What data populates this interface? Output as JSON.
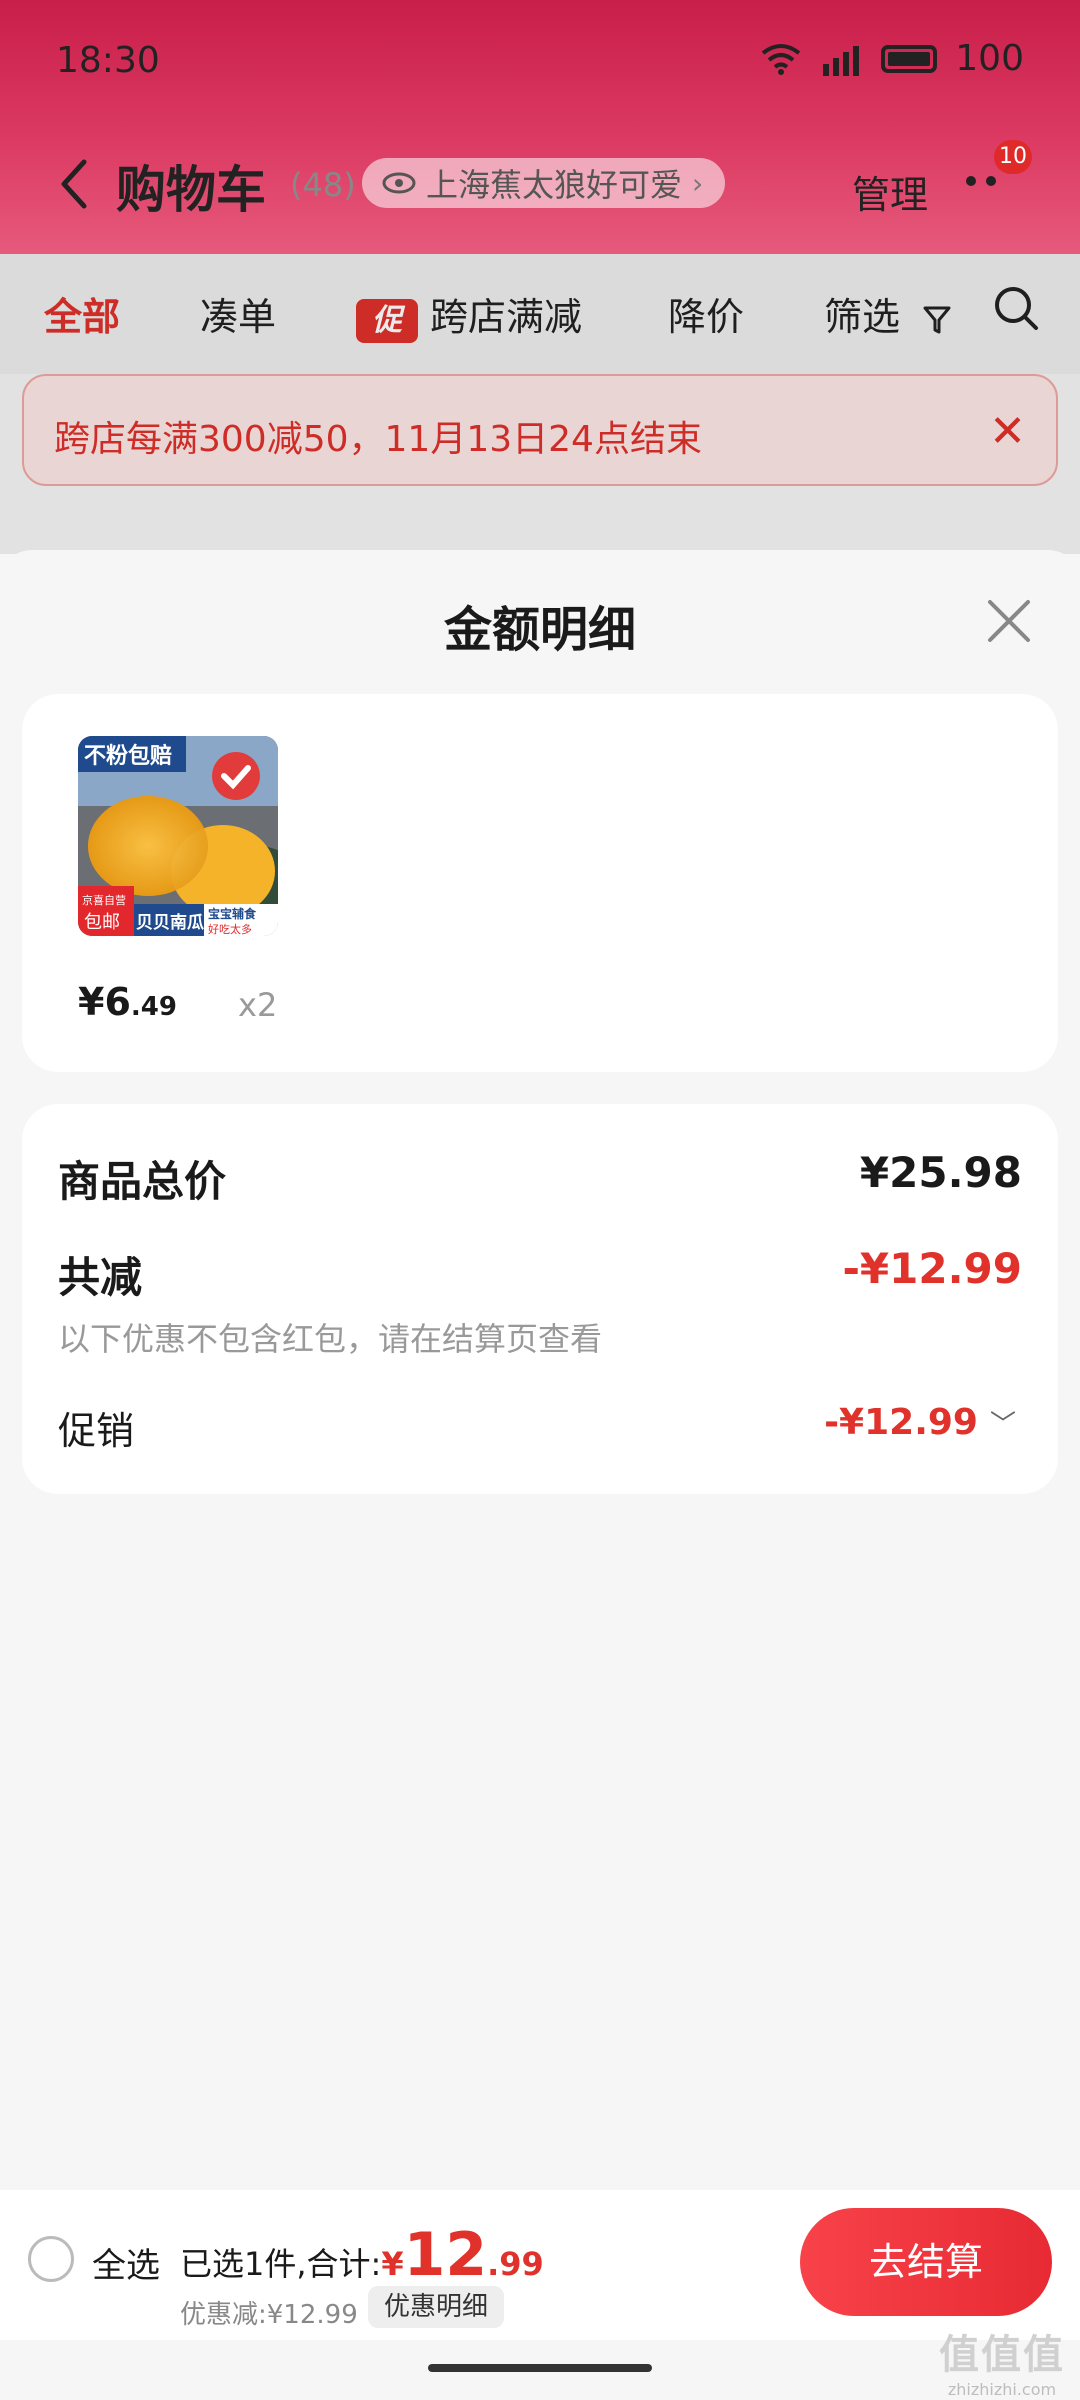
{
  "status_bar": {
    "time": "18:30",
    "battery": "100"
  },
  "nav": {
    "title": "购物车",
    "count": "(48)",
    "address": "上海蕉太狼好可爱",
    "manage": "管理",
    "badge": "10"
  },
  "tabs": {
    "all": "全部",
    "bundle": "凑单",
    "promo_tag": "促",
    "cross_store": "跨店满减",
    "price_drop": "降价",
    "filter": "筛选"
  },
  "banner": {
    "text": "跨店每满300减50，11月13日24点结束"
  },
  "sheet": {
    "title": "金额明细",
    "product": {
      "price_int": "¥6",
      "price_dec": ".49",
      "qty": "x2",
      "img_tag_top": "不粉包赔",
      "img_tag_free": "包邮",
      "img_tag_store": "京喜自营",
      "img_name": "贝贝南瓜",
      "img_side": "宝宝辅食",
      "img_side2": "好吃太多"
    },
    "total_label": "商品总价",
    "total_value": "¥25.98",
    "reduce_label": "共减",
    "reduce_value": "-¥12.99",
    "note": "以下优惠不包含红包，请在结算页查看",
    "promo_label": "促销",
    "promo_value": "-¥12.99"
  },
  "bottom_bar": {
    "select_all": "全选",
    "summary_prefix": "已选1件,合计:",
    "total_yen": "¥",
    "total_int": "12",
    "total_dec": ".99",
    "discount": "优惠减:¥12.99",
    "discount_detail": "优惠明细",
    "checkout": "去结算"
  },
  "watermark": {
    "logo": "值值值",
    "url": "zhizhizhi.com"
  },
  "colors": {
    "accent_red": "#e0312b",
    "header": "#c81e4a",
    "sheet_bg": "#f6f6f6"
  }
}
